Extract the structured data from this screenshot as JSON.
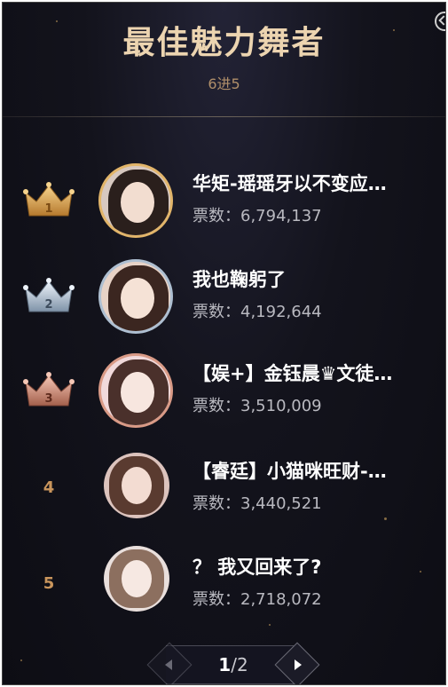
{
  "header": {
    "title": "最佳魅力舞者",
    "subtitle": "6进5"
  },
  "colors": {
    "gold": "#e2b56a",
    "silver": "#aebfd1",
    "bronze": "#d99a86",
    "rank_text": "#c9955c"
  },
  "rankings": [
    {
      "rank": "1",
      "name": "华矩-瑶瑶牙以不变应…",
      "votes": "票数：6,794,137",
      "badge": "gold-crown-icon"
    },
    {
      "rank": "2",
      "name": "我也鞠躬了",
      "votes": "票数：4,192,644",
      "badge": "silver-crown-icon"
    },
    {
      "rank": "3",
      "name": "【娱+】金钰晨♛文徒…",
      "votes": "票数：3,510,009",
      "badge": "bronze-crown-icon"
    },
    {
      "rank": "4",
      "name": "【睿廷】小猫咪旺财-…",
      "votes": "票数：3,440,521",
      "badge": "none"
    },
    {
      "rank": "5",
      "name": "？ 我又回来了?",
      "votes": "票数：2,718,072",
      "badge": "none"
    }
  ],
  "pagination": {
    "current": "1",
    "total": "/2"
  }
}
